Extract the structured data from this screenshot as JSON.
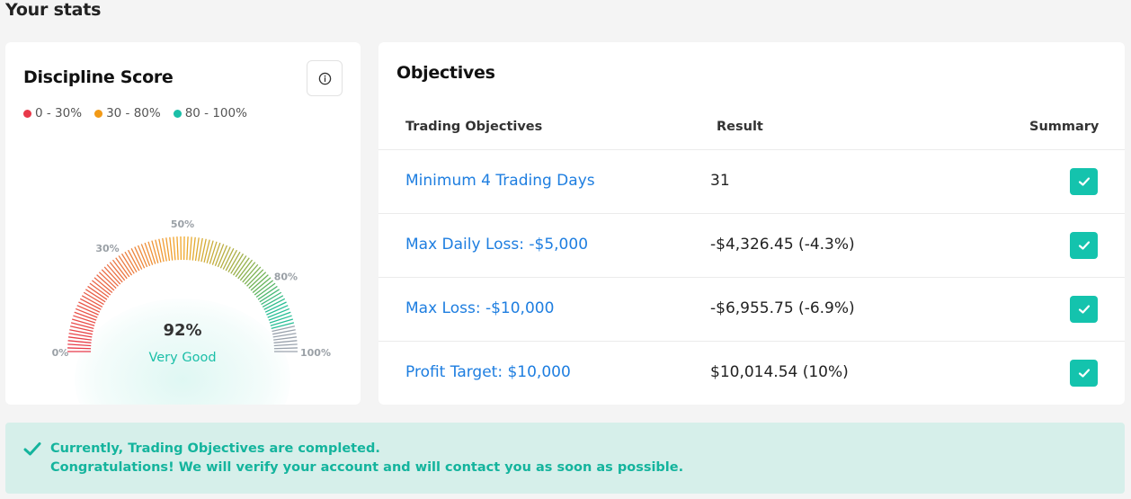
{
  "page": {
    "title": "Your stats"
  },
  "discipline": {
    "title": "Discipline Score",
    "legend": [
      {
        "label": "0 - 30%",
        "color": "#e8394a"
      },
      {
        "label": "30 - 80%",
        "color": "#f29a17"
      },
      {
        "label": "80 - 100%",
        "color": "#1bbfa8"
      }
    ],
    "gauge_labels": [
      "0%",
      "30%",
      "50%",
      "80%",
      "100%"
    ],
    "score": "92%",
    "score_fraction": 0.92,
    "rating": "Very Good",
    "info_icon": "info-circle-icon"
  },
  "objectives": {
    "title": "Objectives",
    "columns": [
      "Trading Objectives",
      "Result",
      "Summary"
    ],
    "rows": [
      {
        "name": "Minimum 4 Trading Days",
        "result": "31"
      },
      {
        "name": "Max Daily Loss: -$5,000",
        "result": "-$4,326.45 (-4.3%)"
      },
      {
        "name": "Max Loss: -$10,000",
        "result": "-$6,955.75 (-6.9%)"
      },
      {
        "name": "Profit Target: $10,000",
        "result": "$10,014.54 (10%)"
      }
    ],
    "check_color": "#14c3ad"
  },
  "banner": {
    "line1": "Currently, Trading Objectives are completed.",
    "line2": "Congratulations! We will verify your account and will contact you as soon as possible.",
    "icon": "check-icon"
  }
}
